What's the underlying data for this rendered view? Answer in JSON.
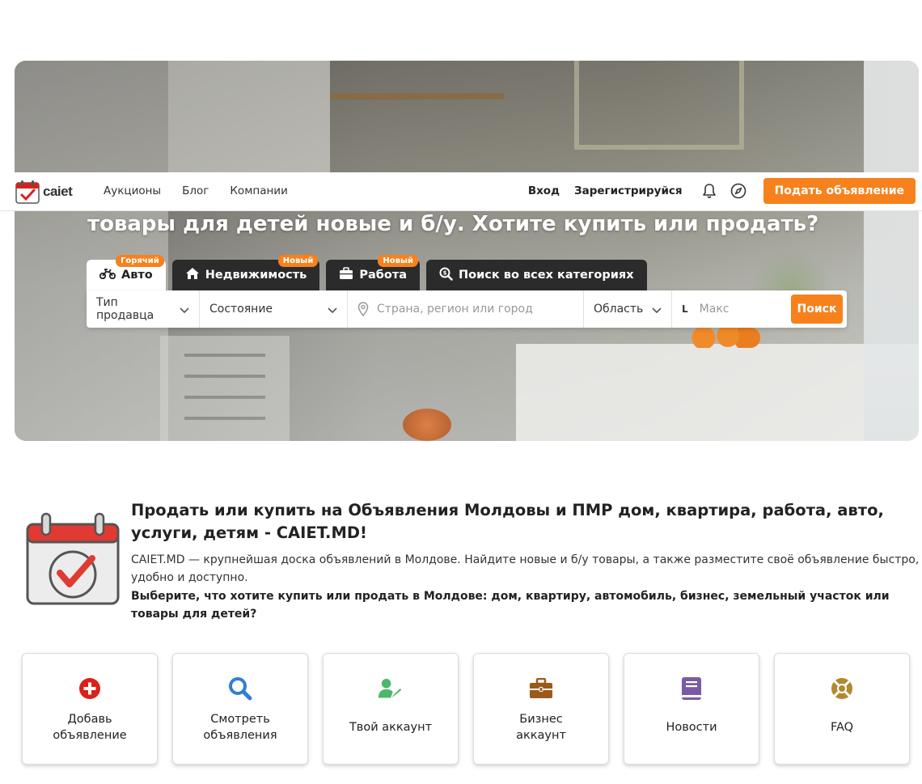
{
  "brand": {
    "logo_text": "caiet"
  },
  "nav": {
    "links": [
      "Аукционы",
      "Блог",
      "Компании"
    ],
    "login": "Вход",
    "register": "Зарегистрируйся",
    "post_button": "Подать объявление"
  },
  "hero": {
    "title": "товары для детей новые и б/у. Хотите купить или продать?"
  },
  "tabs": [
    {
      "label": "Авто",
      "badge": "Горячий",
      "icon": "motorcycle-icon",
      "active": true
    },
    {
      "label": "Недвижимость",
      "badge": "Новый",
      "icon": "home-icon",
      "active": false
    },
    {
      "label": "Работа",
      "badge": "Новый",
      "icon": "briefcase-icon",
      "active": false
    },
    {
      "label": "Поиск во всех категориях",
      "badge": "",
      "icon": "search-dollar-icon",
      "active": false
    }
  ],
  "search": {
    "seller_type": "Тип продавца",
    "state": "Состояние",
    "location_placeholder": "Страна, регион или город",
    "region": "Область",
    "max_unit": "L",
    "max_placeholder": "Макс",
    "button": "Поиск"
  },
  "intro": {
    "title": "Продать или купить на Объявления Молдовы и ПМР дом, квартира, работа, авто, услуги, детям - CAIET.MD!",
    "description": "CAIET.MD — крупнейшая доска объявлений в Молдове. Найдите новые и б/у товары, а также разместите своё объявление быстро, удобно и доступно.",
    "bold": "Выберите, что хотите купить или продать в Молдове: дом, квартиру, автомобиль, бизнес, земельный участок или товары для детей?"
  },
  "cards": [
    {
      "label": "Добавь объявление",
      "icon": "plus-circle-icon",
      "color": "#d9211b"
    },
    {
      "label": "Смотреть объявления",
      "icon": "search-icon",
      "color": "#2f7fd6"
    },
    {
      "label": "Твой аккаунт",
      "icon": "user-edit-icon",
      "color": "#4cb76b"
    },
    {
      "label": "Бизнес аккаунт",
      "icon": "briefcase-icon",
      "color": "#9a5a1a"
    },
    {
      "label": "Новости",
      "icon": "book-icon",
      "color": "#7b5aa6"
    },
    {
      "label": "FAQ",
      "icon": "life-ring-icon",
      "color": "#b08a2e"
    }
  ],
  "colors": {
    "accent": "#f7811d",
    "dark_tab": "#2b2b2b"
  }
}
